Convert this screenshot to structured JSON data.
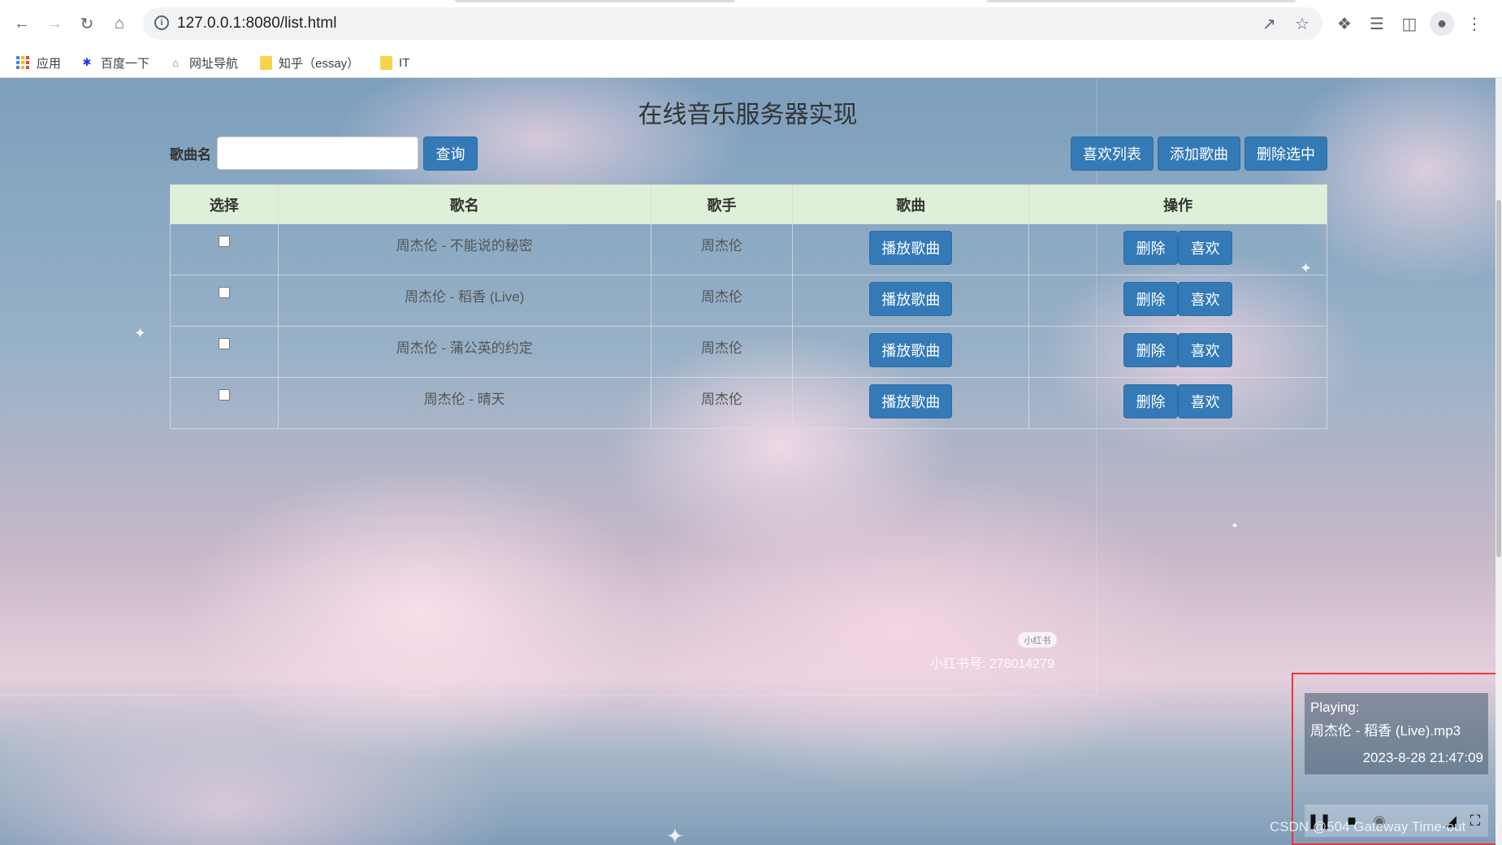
{
  "browser": {
    "url": "127.0.0.1:8080/list.html",
    "bookmarks": [
      {
        "label": "应用",
        "icon": "apps-grid-icon"
      },
      {
        "label": "百度一下",
        "icon": "baidu-paw-icon"
      },
      {
        "label": "网址导航",
        "icon": "nav-house-icon"
      },
      {
        "label": "知乎（essay）",
        "icon": "folder-icon"
      },
      {
        "label": "IT",
        "icon": "folder-icon"
      }
    ]
  },
  "page": {
    "title": "在线音乐服务器实现",
    "search": {
      "label": "歌曲名",
      "value": "",
      "placeholder": "",
      "button": "查询"
    },
    "toolbar": {
      "liked_list": "喜欢列表",
      "add_song": "添加歌曲",
      "delete_selected": "删除选中"
    },
    "table": {
      "headers": [
        "选择",
        "歌名",
        "歌手",
        "歌曲",
        "操作"
      ],
      "rows": [
        {
          "name": "周杰伦 - 不能说的秘密",
          "singer": "周杰伦",
          "play": "播放歌曲",
          "delete": "删除",
          "like": "喜欢"
        },
        {
          "name": "周杰伦 - 稻香 (Live)",
          "singer": "周杰伦",
          "play": "播放歌曲",
          "delete": "删除",
          "like": "喜欢"
        },
        {
          "name": "周杰伦 - 蒲公英的约定",
          "singer": "周杰伦",
          "play": "播放歌曲",
          "delete": "删除",
          "like": "喜欢"
        },
        {
          "name": "周杰伦 - 晴天",
          "singer": "周杰伦",
          "play": "播放歌曲",
          "delete": "删除",
          "like": "喜欢"
        }
      ]
    },
    "watermark": {
      "logo": "小红书",
      "text": "小红书号: 278014279"
    }
  },
  "player": {
    "status_label": "Playing:",
    "song": "周杰伦 - 稻香 (Live).mp3",
    "timestamp": "2023-8-28 21:47:09",
    "controls": [
      "pause-icon",
      "stop-icon",
      "record-icon",
      "volume-icon",
      "fullscreen-icon"
    ]
  },
  "overlay": {
    "csdn": "CSDN @504 Gateway Time-out"
  },
  "colors": {
    "primary_button": "#337ab7",
    "table_header": "#dff0d8",
    "highlight_frame": "#e53935"
  }
}
